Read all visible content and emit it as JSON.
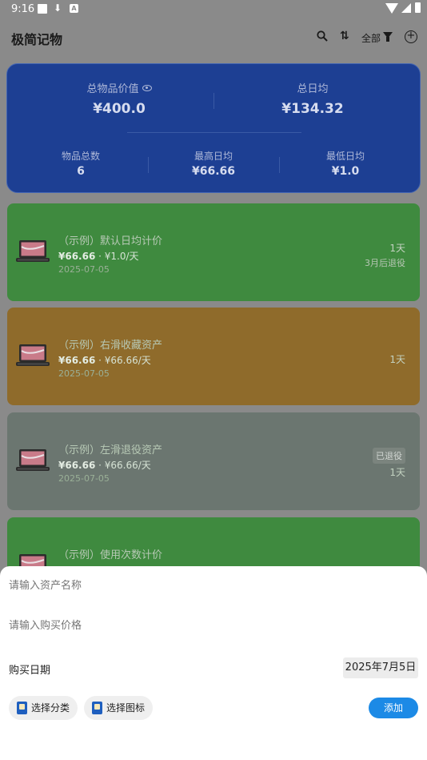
{
  "status_bar": {
    "time": "9:16",
    "a_icon": "A"
  },
  "app": {
    "title": "极简记物",
    "filter_label": "全部",
    "add_symbol": "+",
    "sort_symbol": "⇅"
  },
  "summary": {
    "total_value_label": "总物品价值",
    "total_value": "¥400.0",
    "total_daily_label": "总日均",
    "total_daily": "¥134.32",
    "count_label": "物品总数",
    "count": "6",
    "max_daily_label": "最高日均",
    "max_daily": "¥66.66",
    "min_daily_label": "最低日均",
    "min_daily": "¥1.0"
  },
  "items": [
    {
      "title": "（示例）默认日均计价",
      "price": "¥66.66",
      "rate": " · ¥1.0/天",
      "date": "2025-07-05",
      "days": "1天",
      "sub": "3月后退役"
    },
    {
      "title": "（示例）右滑收藏资产",
      "price": "¥66.66",
      "rate": " · ¥66.66/天",
      "date": "2025-07-05",
      "days": "1天"
    },
    {
      "title": "（示例）左滑退役资产",
      "price": "¥66.66",
      "rate": " · ¥66.66/天",
      "date": "2025-07-05",
      "days": "1天",
      "badge": "已退役"
    },
    {
      "title": "（示例）使用次数计价"
    }
  ],
  "sheet": {
    "name_placeholder": "请输入资产名称",
    "price_placeholder": "请输入购买价格",
    "date_label": "购买日期",
    "date_value": "2025年7月5日",
    "choose_category": "选择分类",
    "choose_icon": "选择图标",
    "add_label": "添加"
  },
  "icons": {
    "search": "search-icon",
    "sort": "sort-icon",
    "filter": "filter-icon",
    "add": "add-circle-icon",
    "eye": "eye-icon",
    "laptop": "laptop-icon",
    "category": "category-icon",
    "image": "image-icon"
  },
  "colors": {
    "summary_bg": "#1d3f93",
    "card_green": "#3f8a3f",
    "card_orange": "#8f6b2b",
    "card_gray": "#6b7670",
    "add_button": "#1c8ae6"
  }
}
